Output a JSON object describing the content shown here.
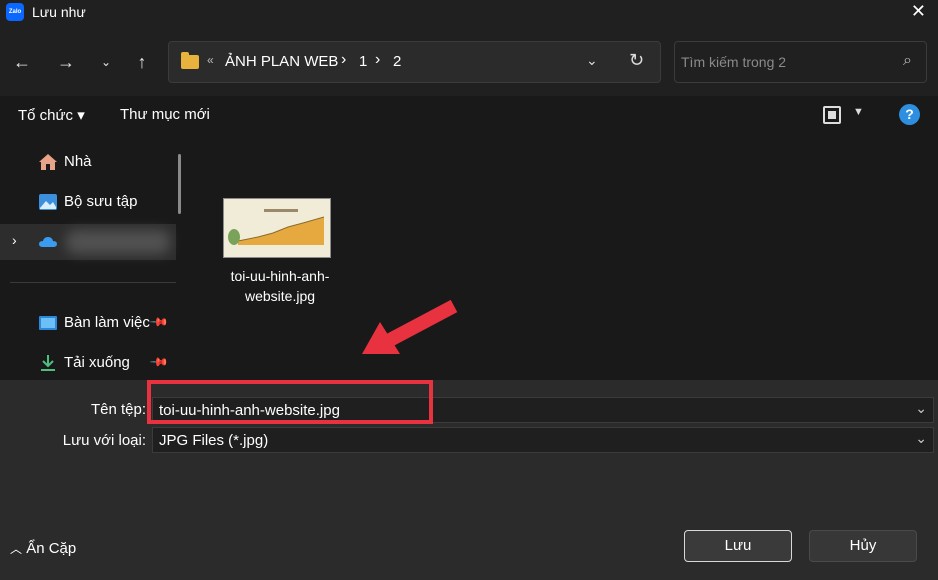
{
  "window": {
    "title": "Lưu như",
    "app_icon_text": "Zalo",
    "close_icon": "close-icon"
  },
  "nav": {
    "back_icon": "arrow-left-icon",
    "forward_icon": "arrow-right-icon",
    "recent_icon": "chevron-down-icon",
    "up_icon": "arrow-up-icon"
  },
  "address": {
    "overflow": "«",
    "crumbs": [
      "ẢNH PLAN WEB",
      "1",
      "2"
    ],
    "separator": "›",
    "refresh_icon": "refresh-icon"
  },
  "search": {
    "placeholder": "Tìm kiếm trong 2",
    "icon": "search-icon"
  },
  "toolbar": {
    "organize_label": "Tổ chức ▾",
    "new_folder_label": "Thư mục mới",
    "help_label": "?"
  },
  "sidebar": {
    "items": [
      {
        "label": "Nhà",
        "icon": "home-icon"
      },
      {
        "label": "Bộ sưu tập",
        "icon": "gallery-icon"
      },
      {
        "label": "",
        "icon": "cloud-icon"
      },
      {
        "label": "Bàn làm việc",
        "icon": "desktop-icon"
      },
      {
        "label": "Tải xuống",
        "icon": "download-icon"
      }
    ]
  },
  "files": [
    {
      "name": "toi-uu-hinh-anh-\nwebsite.jpg",
      "icon": "image-thumbnail"
    }
  ],
  "form": {
    "filename_label": "Tên tệp:",
    "filename_value": "toi-uu-hinh-anh-website.jpg",
    "filetype_label": "Lưu với loại:",
    "filetype_value": "JPG Files (*.jpg)"
  },
  "footer": {
    "hide_folders_label": "Ẩn Cặp",
    "save_label": "Lưu",
    "cancel_label": "Hủy"
  },
  "colors": {
    "annotation": "#e8323f",
    "folder": "#e8b33c",
    "help": "#2e8fe0"
  }
}
